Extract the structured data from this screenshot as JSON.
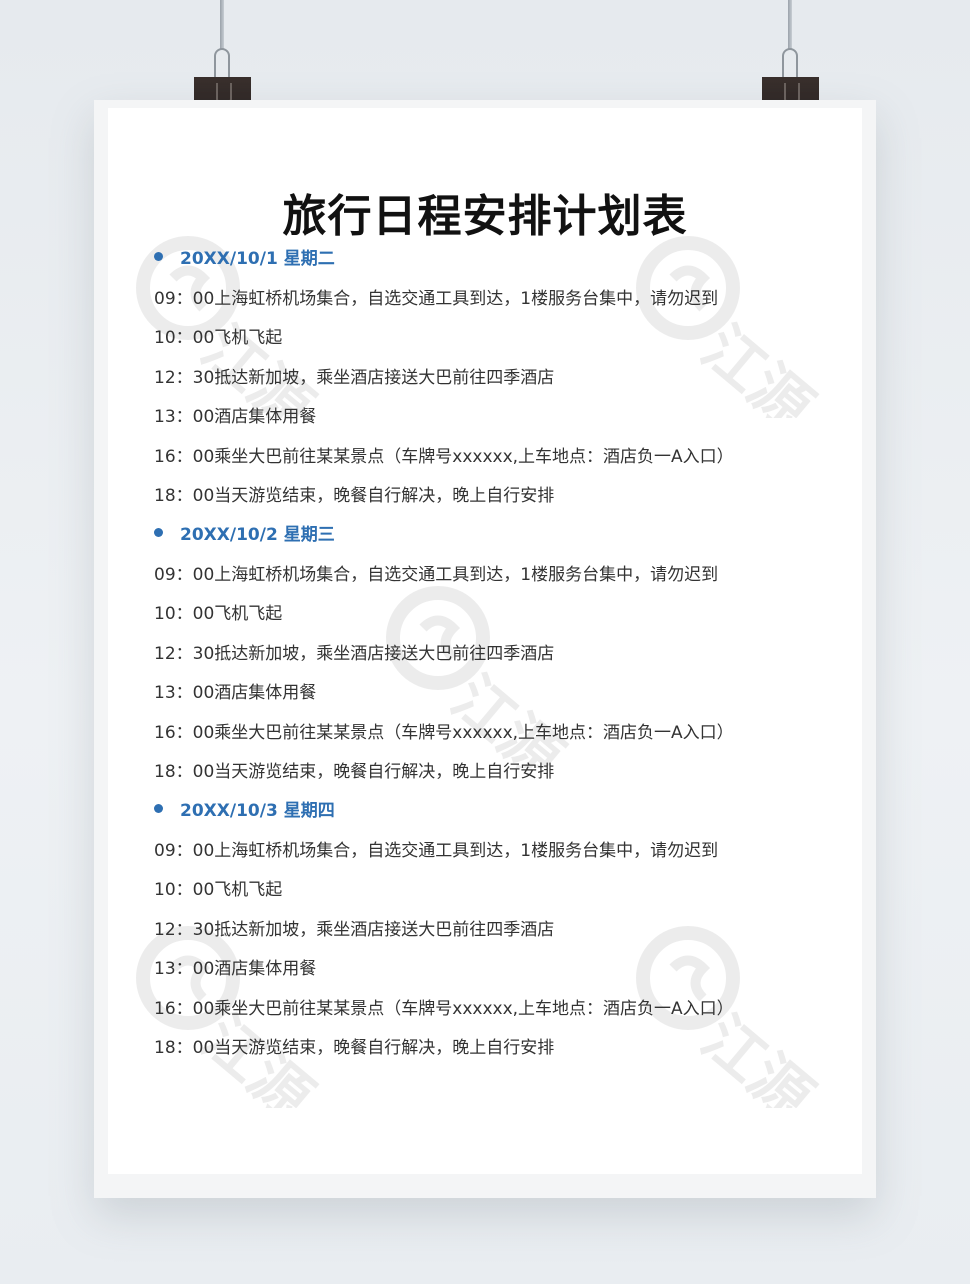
{
  "title": "旅行日程安排计划表",
  "days": [
    {
      "header": "20XX/10/1 星期二",
      "items": [
        "09：00上海虹桥机场集合，自选交通工具到达，1楼服务台集中，请勿迟到",
        "10：00飞机飞起",
        "12：30抵达新加坡，乘坐酒店接送大巴前往四季酒店",
        "13：00酒店集体用餐",
        "16：00乘坐大巴前往某某景点（车牌号xxxxxx,上车地点：酒店负一A入口）",
        "18：00当天游览结束，晚餐自行解决，晚上自行安排"
      ]
    },
    {
      "header": "20XX/10/2 星期三",
      "items": [
        "09：00上海虹桥机场集合，自选交通工具到达，1楼服务台集中，请勿迟到",
        "10：00飞机飞起",
        "12：30抵达新加坡，乘坐酒店接送大巴前往四季酒店",
        "13：00酒店集体用餐",
        "16：00乘坐大巴前往某某景点（车牌号xxxxxx,上车地点：酒店负一A入口）",
        "18：00当天游览结束，晚餐自行解决，晚上自行安排"
      ]
    },
    {
      "header": "20XX/10/3 星期四",
      "items": [
        "09：00上海虹桥机场集合，自选交通工具到达，1楼服务台集中，请勿迟到",
        "10：00飞机飞起",
        "12：30抵达新加坡，乘坐酒店接送大巴前往四季酒店",
        "13：00酒店集体用餐",
        "16：00乘坐大巴前往某某景点（车牌号xxxxxx,上车地点：酒店负一A入口）",
        "18：00当天游览结束，晚餐自行解决，晚上自行安排"
      ]
    }
  ],
  "watermark_text": "江源",
  "colors": {
    "accent": "#2e6fb2",
    "text": "#333333",
    "title": "#111111",
    "background": "#e4e8ec"
  }
}
